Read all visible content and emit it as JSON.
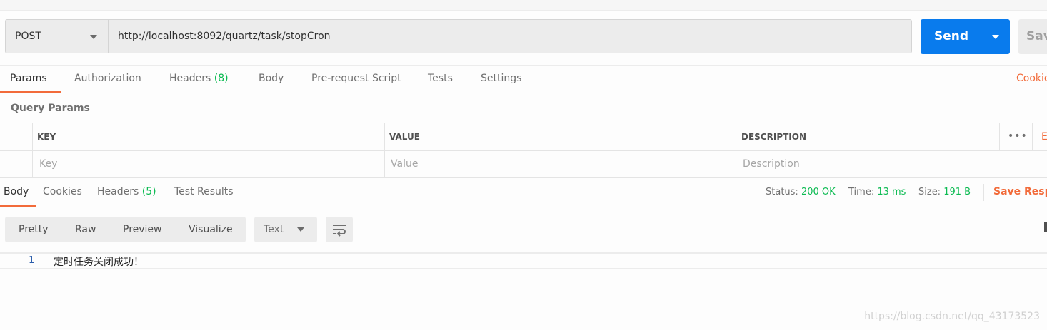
{
  "request": {
    "method": "POST",
    "url": "http://localhost:8092/quartz/task/stopCron",
    "send_label": "Send",
    "save_label": "Sav"
  },
  "request_tabs": {
    "params": "Params",
    "authorization": "Authorization",
    "headers": "Headers",
    "headers_count": "(8)",
    "body": "Body",
    "prerequest": "Pre-request Script",
    "tests": "Tests",
    "settings": "Settings",
    "cookies": "Cookie"
  },
  "params": {
    "title": "Query Params",
    "columns": {
      "key": "KEY",
      "value": "VALUE",
      "description": "DESCRIPTION"
    },
    "placeholders": {
      "key": "Key",
      "value": "Value",
      "description": "Description"
    },
    "more": "•••",
    "bulk_edit": "E"
  },
  "response_tabs": {
    "body": "Body",
    "cookies": "Cookies",
    "headers": "Headers",
    "headers_count": "(5)",
    "test_results": "Test Results"
  },
  "response_status": {
    "status_label": "Status:",
    "status_value": "200 OK",
    "time_label": "Time:",
    "time_value": "13 ms",
    "size_label": "Size:",
    "size_value": "191 B",
    "save_response": "Save Respo"
  },
  "view": {
    "options": [
      "Pretty",
      "Raw",
      "Preview",
      "Visualize"
    ],
    "format": "Text"
  },
  "response_body": {
    "line_number": "1",
    "line_text": "定时任务关闭成功！"
  },
  "watermark": "https://blog.csdn.net/qq_43173523",
  "colors": {
    "accent": "#f26b3a",
    "send": "#097bed",
    "success": "#0cbb52"
  }
}
